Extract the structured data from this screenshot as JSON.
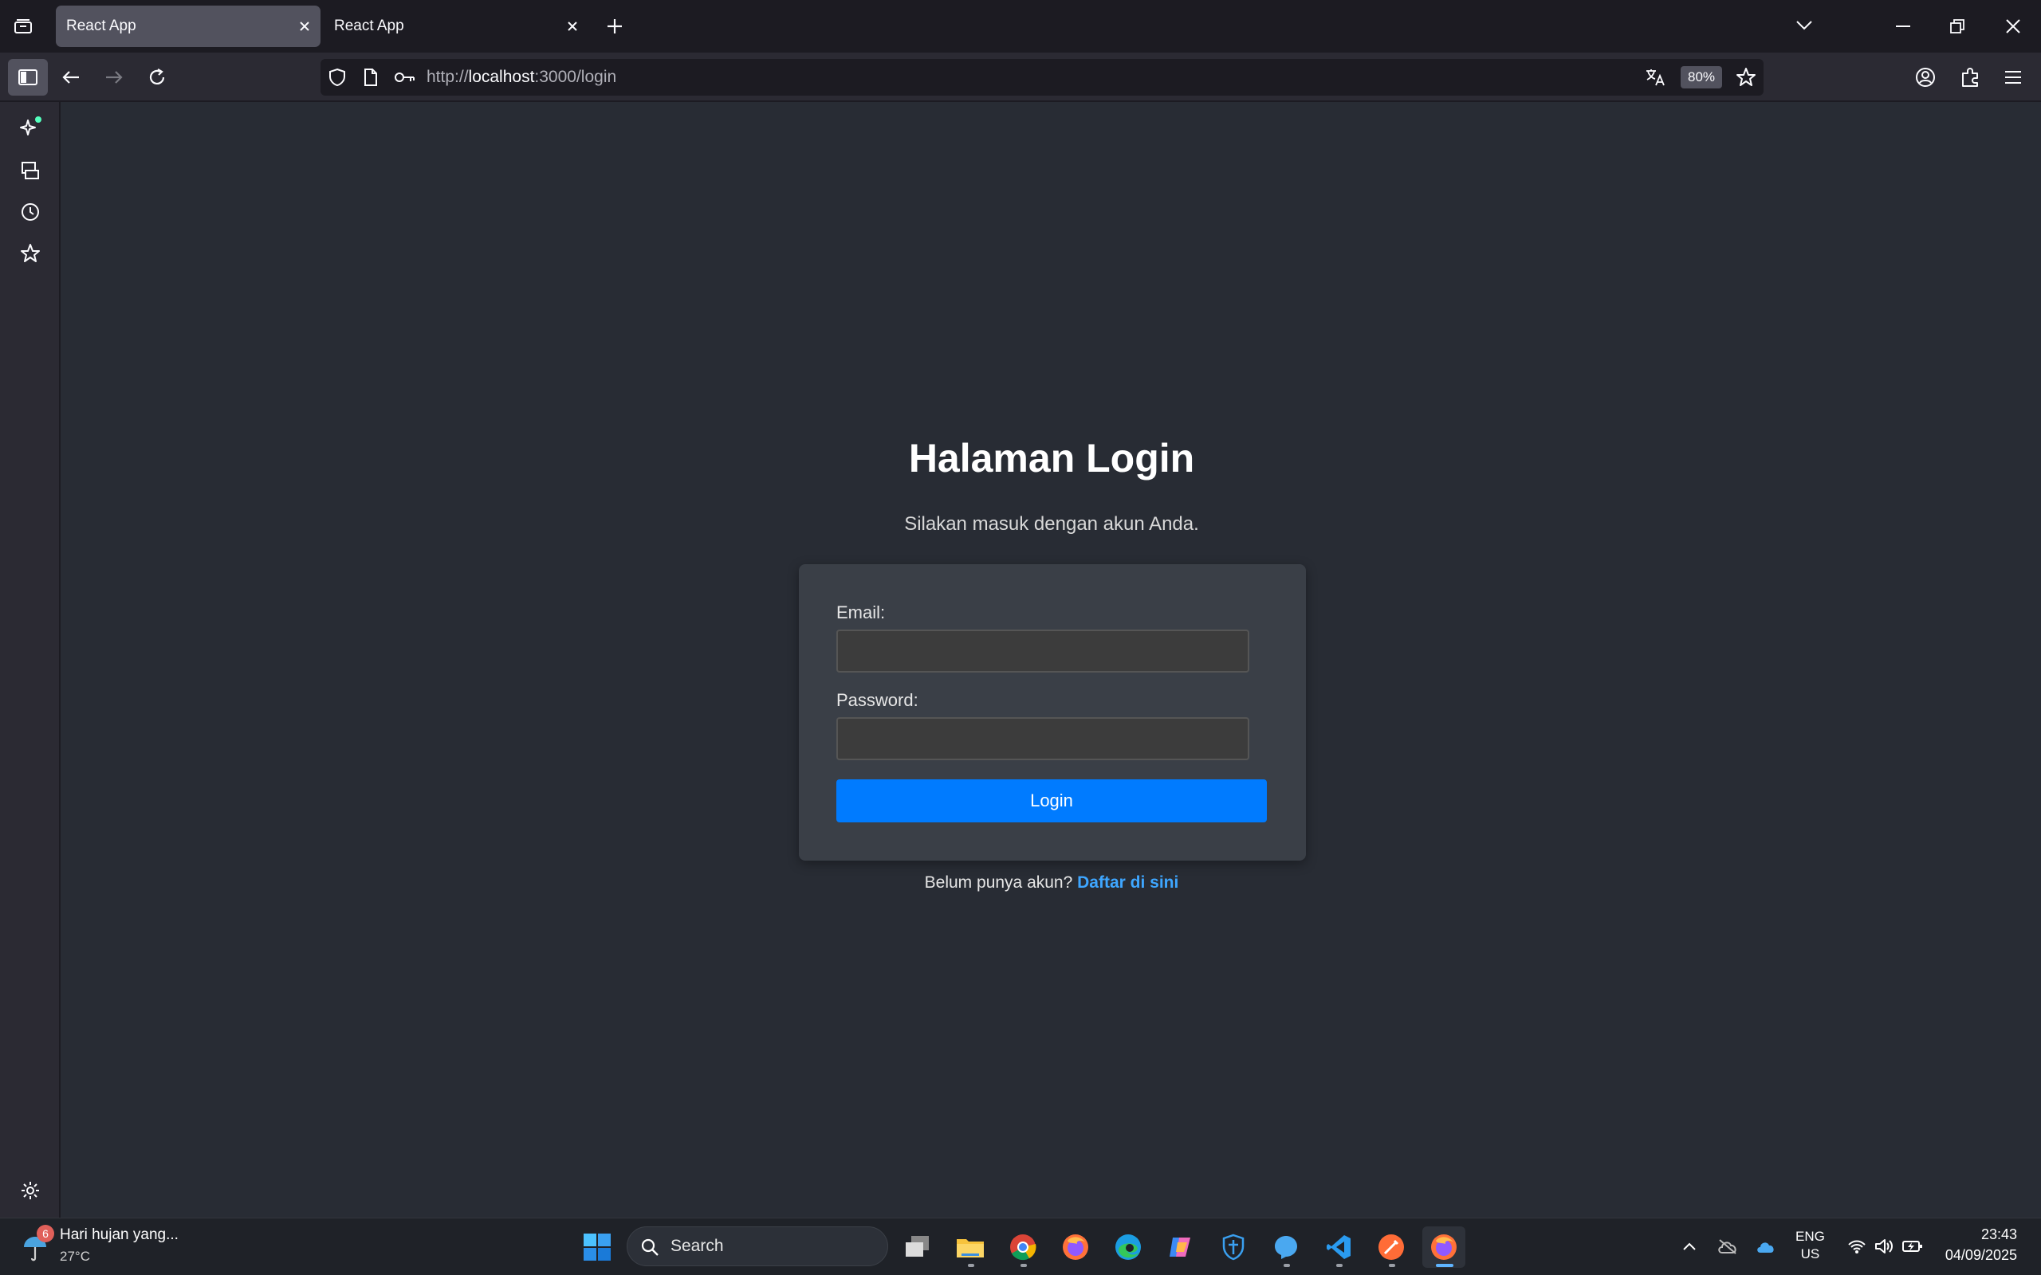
{
  "browser": {
    "tabs": [
      {
        "label": "React App",
        "active": true
      },
      {
        "label": "React App",
        "active": false
      }
    ],
    "url": {
      "scheme": "http://",
      "host": "localhost",
      "path": ":3000/login"
    },
    "zoom": "80%"
  },
  "page": {
    "title": "Halaman Login",
    "subtitle": "Silakan masuk dengan akun Anda.",
    "form": {
      "email_label": "Email:",
      "email_value": "",
      "password_label": "Password:",
      "password_value": "",
      "submit_label": "Login"
    },
    "register_prompt": "Belum punya akun?",
    "register_link": "Daftar di sini"
  },
  "taskbar": {
    "weather": {
      "text": "Hari hujan yang...",
      "temp": "27°C",
      "badge": "6"
    },
    "search_label": "Search",
    "lang_line1": "ENG",
    "lang_line2": "US",
    "time": "23:43",
    "date": "04/09/2025"
  },
  "colors": {
    "accent": "#007bff",
    "link": "#3ea6ff",
    "page_bg": "#282c34",
    "card_bg": "#3a3f47"
  }
}
